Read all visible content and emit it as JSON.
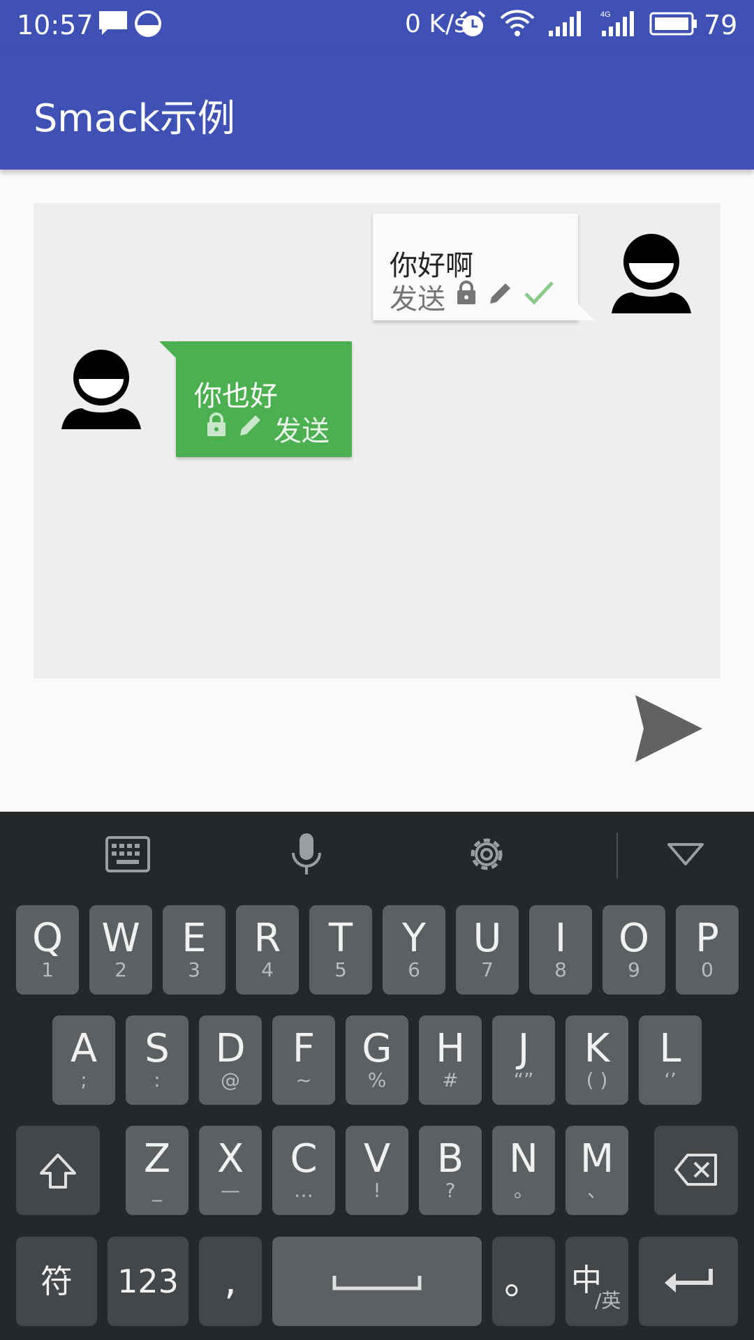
{
  "status_bar": {
    "time": "10:57",
    "net_speed": "0 K/s",
    "battery": "79",
    "icons": [
      "message-icon",
      "sync-icon",
      "alarm-icon",
      "wifi-icon",
      "signal-icon",
      "signal-4g-icon",
      "battery-icon"
    ]
  },
  "app_bar": {
    "title": "Smack示例"
  },
  "chat": {
    "messages": [
      {
        "direction": "incoming",
        "text": "你好啊",
        "status": "发送",
        "icons": [
          "lock-icon",
          "edit-icon",
          "check-icon"
        ]
      },
      {
        "direction": "outgoing",
        "text": "你也好",
        "status": "发送",
        "icons": [
          "lock-icon",
          "edit-icon"
        ]
      }
    ]
  },
  "input_bar": {
    "send_icon": "send-icon"
  },
  "keyboard": {
    "toolbar": [
      "keyboard-icon",
      "mic-icon",
      "settings-icon",
      "collapse-icon"
    ],
    "row1": [
      {
        "main": "Q",
        "sub": "1"
      },
      {
        "main": "W",
        "sub": "2"
      },
      {
        "main": "E",
        "sub": "3"
      },
      {
        "main": "R",
        "sub": "4"
      },
      {
        "main": "T",
        "sub": "5"
      },
      {
        "main": "Y",
        "sub": "6"
      },
      {
        "main": "U",
        "sub": "7"
      },
      {
        "main": "I",
        "sub": "8"
      },
      {
        "main": "O",
        "sub": "9"
      },
      {
        "main": "P",
        "sub": "0"
      }
    ],
    "row2": [
      {
        "main": "A",
        "sub": ";"
      },
      {
        "main": "S",
        "sub": ":"
      },
      {
        "main": "D",
        "sub": "@"
      },
      {
        "main": "F",
        "sub": "~"
      },
      {
        "main": "G",
        "sub": "%"
      },
      {
        "main": "H",
        "sub": "#"
      },
      {
        "main": "J",
        "sub": "“”"
      },
      {
        "main": "K",
        "sub": "( )"
      },
      {
        "main": "L",
        "sub": "‘’"
      }
    ],
    "row3": [
      {
        "main": "Z",
        "sub": "_"
      },
      {
        "main": "X",
        "sub": "—"
      },
      {
        "main": "C",
        "sub": "…"
      },
      {
        "main": "V",
        "sub": "!"
      },
      {
        "main": "B",
        "sub": "?"
      },
      {
        "main": "N",
        "sub": "。"
      },
      {
        "main": "M",
        "sub": "、"
      }
    ],
    "bottom": {
      "symbols": "符",
      "numbers": "123",
      "comma": ",",
      "period": "。",
      "lang_main": "中",
      "lang_sub": "/英"
    }
  },
  "colors": {
    "primary": "#3f51b5",
    "accent_green": "#4caf50",
    "keyboard_bg": "#24282b"
  }
}
